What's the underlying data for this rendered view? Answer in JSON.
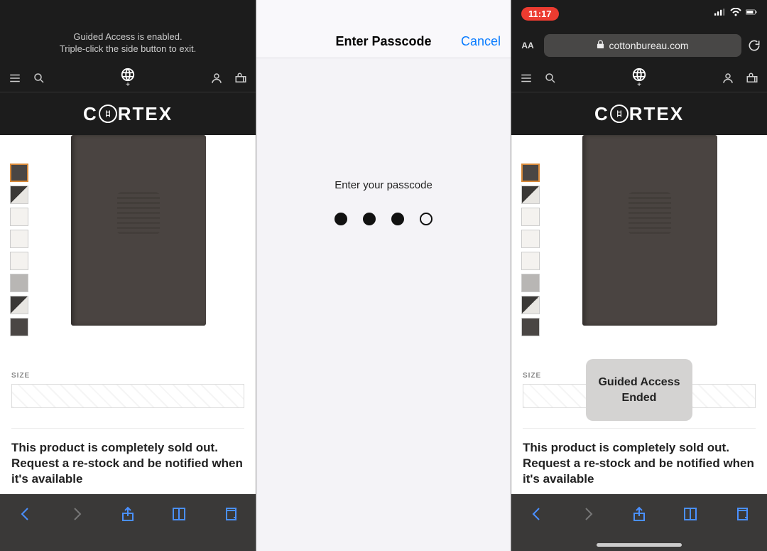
{
  "panel1": {
    "banner_line1": "Guided Access is enabled.",
    "banner_line2": "Triple-click the side button to exit.",
    "brand": "CORTEX",
    "size_label": "SIZE",
    "soldout_text": "This product is completely sold out. Request a re-stock and be notified when it's available"
  },
  "passcode": {
    "title": "Enter Passcode",
    "cancel": "Cancel",
    "prompt": "Enter your passcode",
    "entered": 3,
    "total": 4
  },
  "panel3": {
    "time": "11:17",
    "domain": "cottonbureau.com",
    "aa_label": "AA",
    "brand": "CORTEX",
    "size_label": "SIZE",
    "soldout_text": "This product is completely sold out. Request a re-stock and be notified when it's available",
    "toast_line1": "Guided Access",
    "toast_line2": "Ended"
  }
}
